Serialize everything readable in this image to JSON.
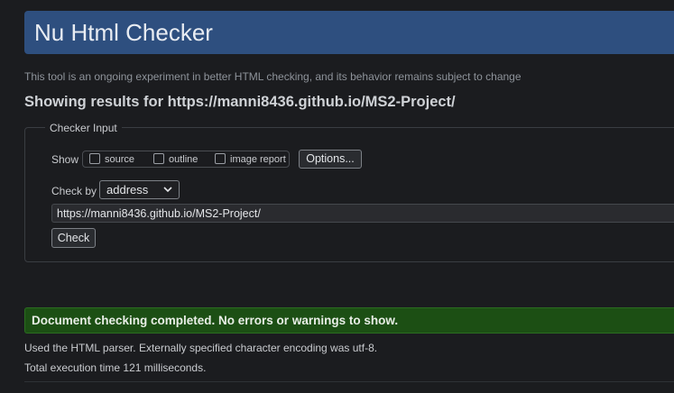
{
  "header": {
    "title": "Nu Html Checker",
    "tagline": "This tool is an ongoing experiment in better HTML checking, and its behavior remains subject to change"
  },
  "results": {
    "heading": "Showing results for https://manni8436.github.io/MS2-Project/"
  },
  "checker_input": {
    "legend": "Checker Input",
    "show_label": "Show",
    "options": [
      {
        "label": "source",
        "checked": false
      },
      {
        "label": "outline",
        "checked": false
      },
      {
        "label": "image report",
        "checked": false
      }
    ],
    "options_button": "Options...",
    "check_by_label": "Check by",
    "check_by_value": "address",
    "url_value": "https://manni8436.github.io/MS2-Project/",
    "check_button": "Check"
  },
  "status": {
    "message": "Document checking completed. No errors or warnings to show.",
    "parser_info": "Used the HTML parser. Externally specified character encoding was utf-8.",
    "execution_time": "Total execution time 121 milliseconds."
  },
  "colors": {
    "banner": "#2e4f7f",
    "success": "#1c4f14",
    "background": "#1b1c1f"
  }
}
